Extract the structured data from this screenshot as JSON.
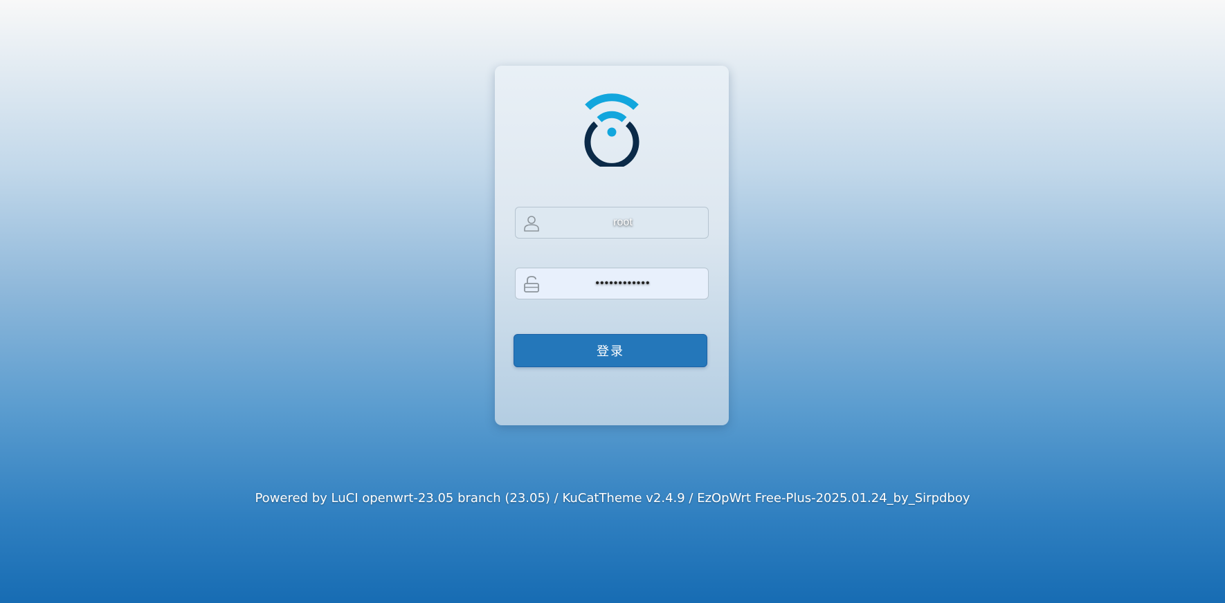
{
  "login": {
    "username": {
      "value": "root",
      "icon": "user-icon"
    },
    "password": {
      "value": "••••••••••••",
      "icon": "unlock-icon"
    },
    "submit_label": "登录"
  },
  "logo": {
    "icon": "wifi-logo-icon",
    "colors": {
      "accent": "#12a6dd",
      "ring": "#0b2a48"
    }
  },
  "footer": {
    "text": "Powered by LuCI openwrt-23.05 branch (23.05) / KuCatTheme v2.4.9 / EzOpWrt Free-Plus-2025.01.24_by_Sirpdboy"
  },
  "colors": {
    "button": "#2477ba"
  }
}
